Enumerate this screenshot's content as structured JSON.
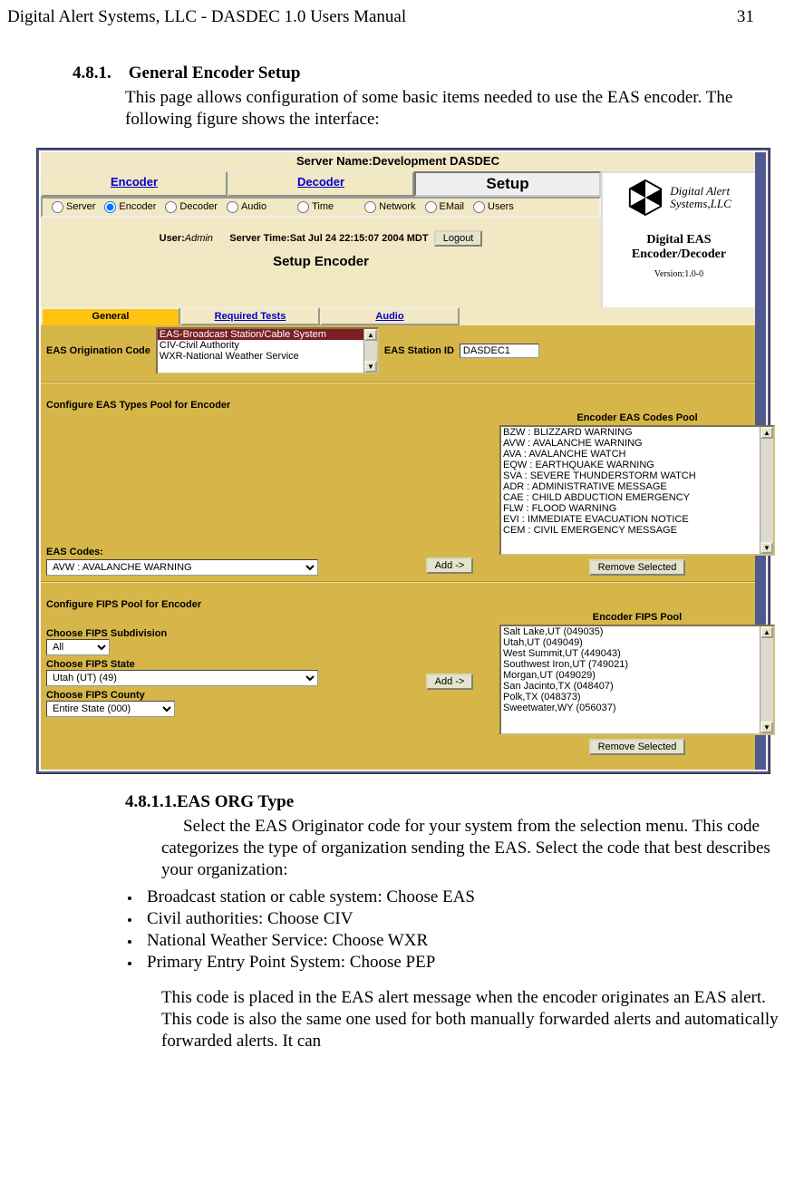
{
  "doc": {
    "header_left": "Digital Alert Systems, LLC - DASDEC 1.0 Users Manual",
    "page_number": "31",
    "sec_num": "4.8.1.",
    "sec_title": "General Encoder Setup",
    "sec_intro": "This page allows configuration of some basic items needed to use the EAS encoder. The following figure shows the interface:",
    "sub_num": "4.8.1.1.",
    "sub_title": "EAS ORG Type",
    "sub_body": "Select the EAS Originator code for your system from the selection menu. This code categorizes the type of organization sending the EAS. Select the code that best describes your organization:",
    "bullets": [
      "Broadcast station or cable system: Choose EAS",
      "Civil authorities: Choose CIV",
      "National Weather Service: Choose WXR",
      "Primary Entry Point System: Choose PEP"
    ],
    "continuation": "This code is placed in the EAS alert message when the encoder originates an EAS alert. This code is also the same one used for both manually forwarded alerts and automatically forwarded alerts. It can"
  },
  "ui": {
    "server_name_label": "Server Name:Development DASDEC",
    "main_tabs": {
      "encoder": "Encoder",
      "decoder": "Decoder",
      "setup": "Setup"
    },
    "radios": [
      "Server",
      "Encoder",
      "Decoder",
      "Audio",
      "Time",
      "Network",
      "EMail",
      "Users"
    ],
    "radio_selected": "Encoder",
    "user_label": "User:",
    "user_value": "Admin",
    "server_time_label": "Server Time:",
    "server_time_value": "Sat Jul 24 22:15:07 2004 MDT",
    "logout": "Logout",
    "section_title": "Setup Encoder",
    "sub_tabs": [
      "General",
      "Required Tests",
      "Audio"
    ],
    "origination_label": "EAS Origination Code",
    "origin_options": [
      "EAS-Broadcast Station/Cable System",
      "CIV-Civil Authority",
      "WXR-National Weather Service"
    ],
    "station_id_label": "EAS Station ID",
    "station_id_value": "DASDEC1",
    "types_pool_header": "Configure EAS Types Pool for Encoder",
    "eas_codes_label": "EAS Codes:",
    "eas_codes_selected": "AVW : AVALANCHE WARNING",
    "add_btn": "Add ->",
    "codes_pool_header": "Encoder EAS Codes Pool",
    "codes_pool": [
      "BZW : BLIZZARD WARNING",
      "AVW : AVALANCHE WARNING",
      "AVA : AVALANCHE WATCH",
      "EQW : EARTHQUAKE WARNING",
      "SVA : SEVERE THUNDERSTORM WATCH",
      "ADR : ADMINISTRATIVE MESSAGE",
      "CAE : CHILD ABDUCTION EMERGENCY",
      "FLW : FLOOD WARNING",
      "EVI : IMMEDIATE EVACUATION NOTICE",
      "CEM : CIVIL EMERGENCY MESSAGE"
    ],
    "remove_selected": "Remove Selected",
    "fips_pool_header": "Configure FIPS Pool for Encoder",
    "fips_sub_label": "Choose FIPS Subdivision",
    "fips_sub_value": "All",
    "fips_state_label": "Choose FIPS State",
    "fips_state_value": "Utah (UT) (49)",
    "fips_county_label": "Choose FIPS County",
    "fips_county_value": "Entire State (000)",
    "fips_pool_title": "Encoder FIPS Pool",
    "fips_pool": [
      "Salt Lake,UT (049035)",
      "Utah,UT (049049)",
      "West Summit,UT (449043)",
      "Southwest Iron,UT (749021)",
      "Morgan,UT (049029)",
      "San Jacinto,TX (048407)",
      "Polk,TX (048373)",
      "Sweetwater,WY (056037)"
    ],
    "brand": {
      "name1": "Digital Alert",
      "name2": "Systems,LLC",
      "product": "Digital EAS Encoder/Decoder",
      "version": "Version:1.0-0"
    }
  }
}
